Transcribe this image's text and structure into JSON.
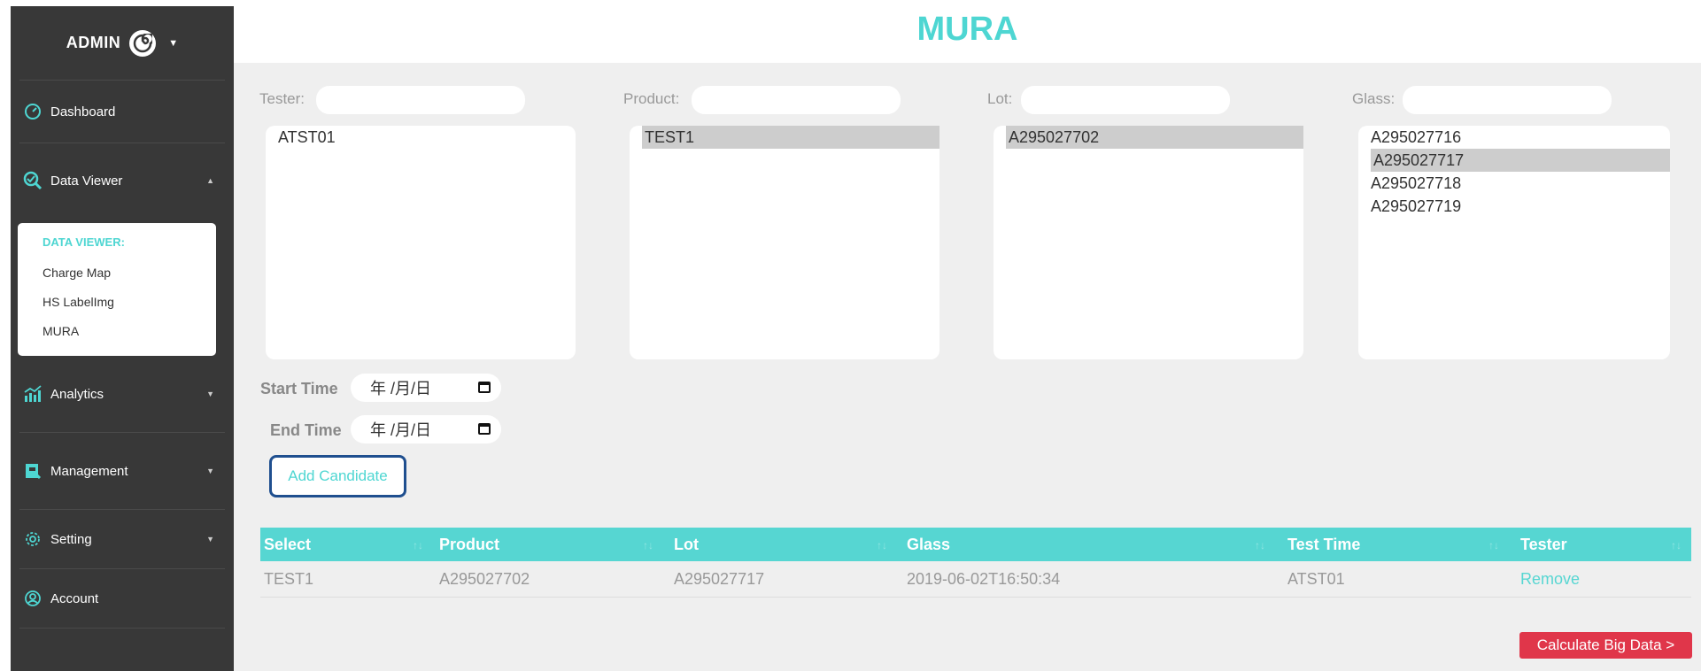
{
  "sidebar": {
    "admin_label": "ADMIN",
    "items": [
      {
        "label": "Dashboard",
        "icon": "dashboard-icon"
      },
      {
        "label": "Data Viewer",
        "icon": "data-viewer-icon"
      },
      {
        "label": "Analytics",
        "icon": "analytics-icon"
      },
      {
        "label": "Management",
        "icon": "management-icon"
      },
      {
        "label": "Setting",
        "icon": "gear-icon"
      },
      {
        "label": "Account",
        "icon": "account-icon"
      }
    ],
    "submenu": {
      "title": "DATA VIEWER:",
      "items": [
        "Charge Map",
        "HS LabelImg",
        "MURA"
      ]
    }
  },
  "page": {
    "title": "MURA"
  },
  "filters": {
    "tester": {
      "label": "Tester:",
      "options": [
        "ATST01"
      ],
      "selected": ""
    },
    "product": {
      "label": "Product:",
      "options": [
        "TEST1"
      ],
      "selected": "TEST1"
    },
    "lot": {
      "label": "Lot:",
      "options": [
        "A295027702"
      ],
      "selected": "A295027702"
    },
    "glass": {
      "label": "Glass:",
      "options": [
        "A295027716",
        "A295027717",
        "A295027718",
        "A295027719"
      ],
      "selected": "A295027717"
    }
  },
  "time": {
    "start_label": "Start Time",
    "end_label": "End Time",
    "start_value": "年 /月/日",
    "end_value": "年 /月/日"
  },
  "add_candidate_label": "Add Candidate",
  "table": {
    "headers": [
      "Select",
      "Product",
      "Lot",
      "Glass",
      "Test Time",
      "Tester"
    ],
    "rows": [
      [
        "TEST1",
        "A295027702",
        "A295027717",
        "2019-06-02T16:50:34",
        "ATST01",
        "Remove"
      ]
    ]
  },
  "calculate_label": "Calculate Big Data >",
  "colors": {
    "accent": "#56d6d2",
    "sidebar": "#383838",
    "danger": "#e0364a",
    "focus": "#1f4f8f"
  }
}
